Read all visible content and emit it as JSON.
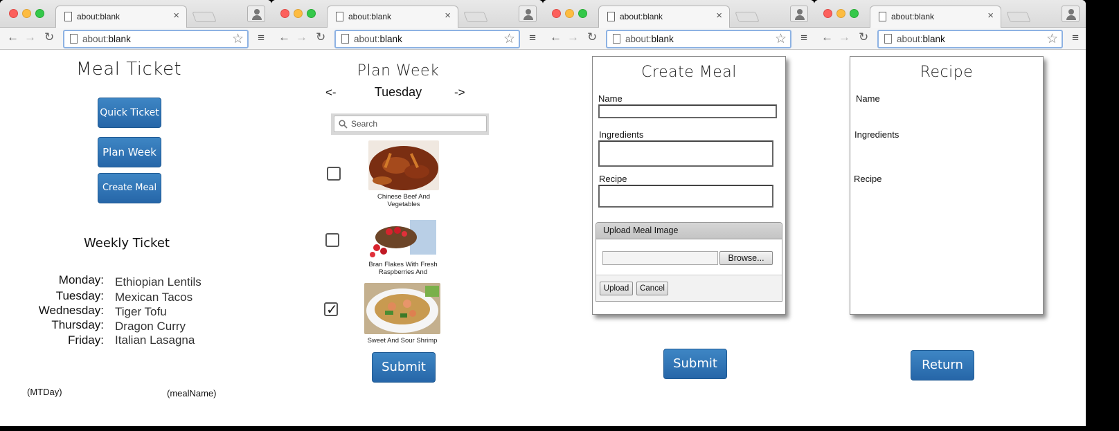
{
  "browser": {
    "tab_title": "about:blank",
    "tab_close": "×",
    "url_prefix": "about:",
    "url_main": "blank",
    "nav_back": "←",
    "nav_forward": "→",
    "nav_reload": "↻",
    "star_glyph": "☆",
    "menu_glyph": "≡"
  },
  "screen1": {
    "title": "Meal Ticket",
    "buttons": [
      "Quick Ticket",
      "Plan Week",
      "Create Meal"
    ],
    "weekly_title": "Weekly Ticket",
    "schedule": [
      {
        "day": "Monday:",
        "meal": "Ethiopian Lentils"
      },
      {
        "day": "Tuesday:",
        "meal": "Mexican Tacos"
      },
      {
        "day": "Wednesday:",
        "meal": "Tiger Tofu"
      },
      {
        "day": "Thursday:",
        "meal": "Dragon Curry"
      },
      {
        "day": "Friday:",
        "meal": "Italian Lasagna"
      }
    ],
    "footnote_left": "(MTDay)",
    "footnote_right": "(mealName)"
  },
  "screen2": {
    "title": "Plan Week",
    "prev": "<-",
    "day": "Tuesday",
    "next": "->",
    "search_placeholder": "Search",
    "meals": [
      {
        "caption_line1": "Chinese Beef And",
        "caption_line2": "Vegetables",
        "checked": false
      },
      {
        "caption_line1": "Bran Flakes With Fresh",
        "caption_line2": "Raspberries And",
        "checked": false
      },
      {
        "caption_line1": "Sweet And Sour Shrimp",
        "caption_line2": "",
        "checked": true
      }
    ],
    "check_mark": "✓",
    "submit": "Submit"
  },
  "screen3": {
    "title": "Create Meal",
    "name_label": "Name",
    "ingredients_label": "Ingredients",
    "recipe_label": "Recipe",
    "upload_header": "Upload Meal Image",
    "browse": "Browse...",
    "upload": "Upload",
    "cancel": "Cancel",
    "submit": "Submit"
  },
  "screen4": {
    "title": "Recipe",
    "name_label": "Name",
    "ingredients_label": "Ingredients",
    "recipe_label": "Recipe",
    "return": "Return"
  },
  "colors": {
    "button_blue": "#2d72b6",
    "window_bg": "#ffffff",
    "chrome_bar": "#e4e4e4"
  }
}
